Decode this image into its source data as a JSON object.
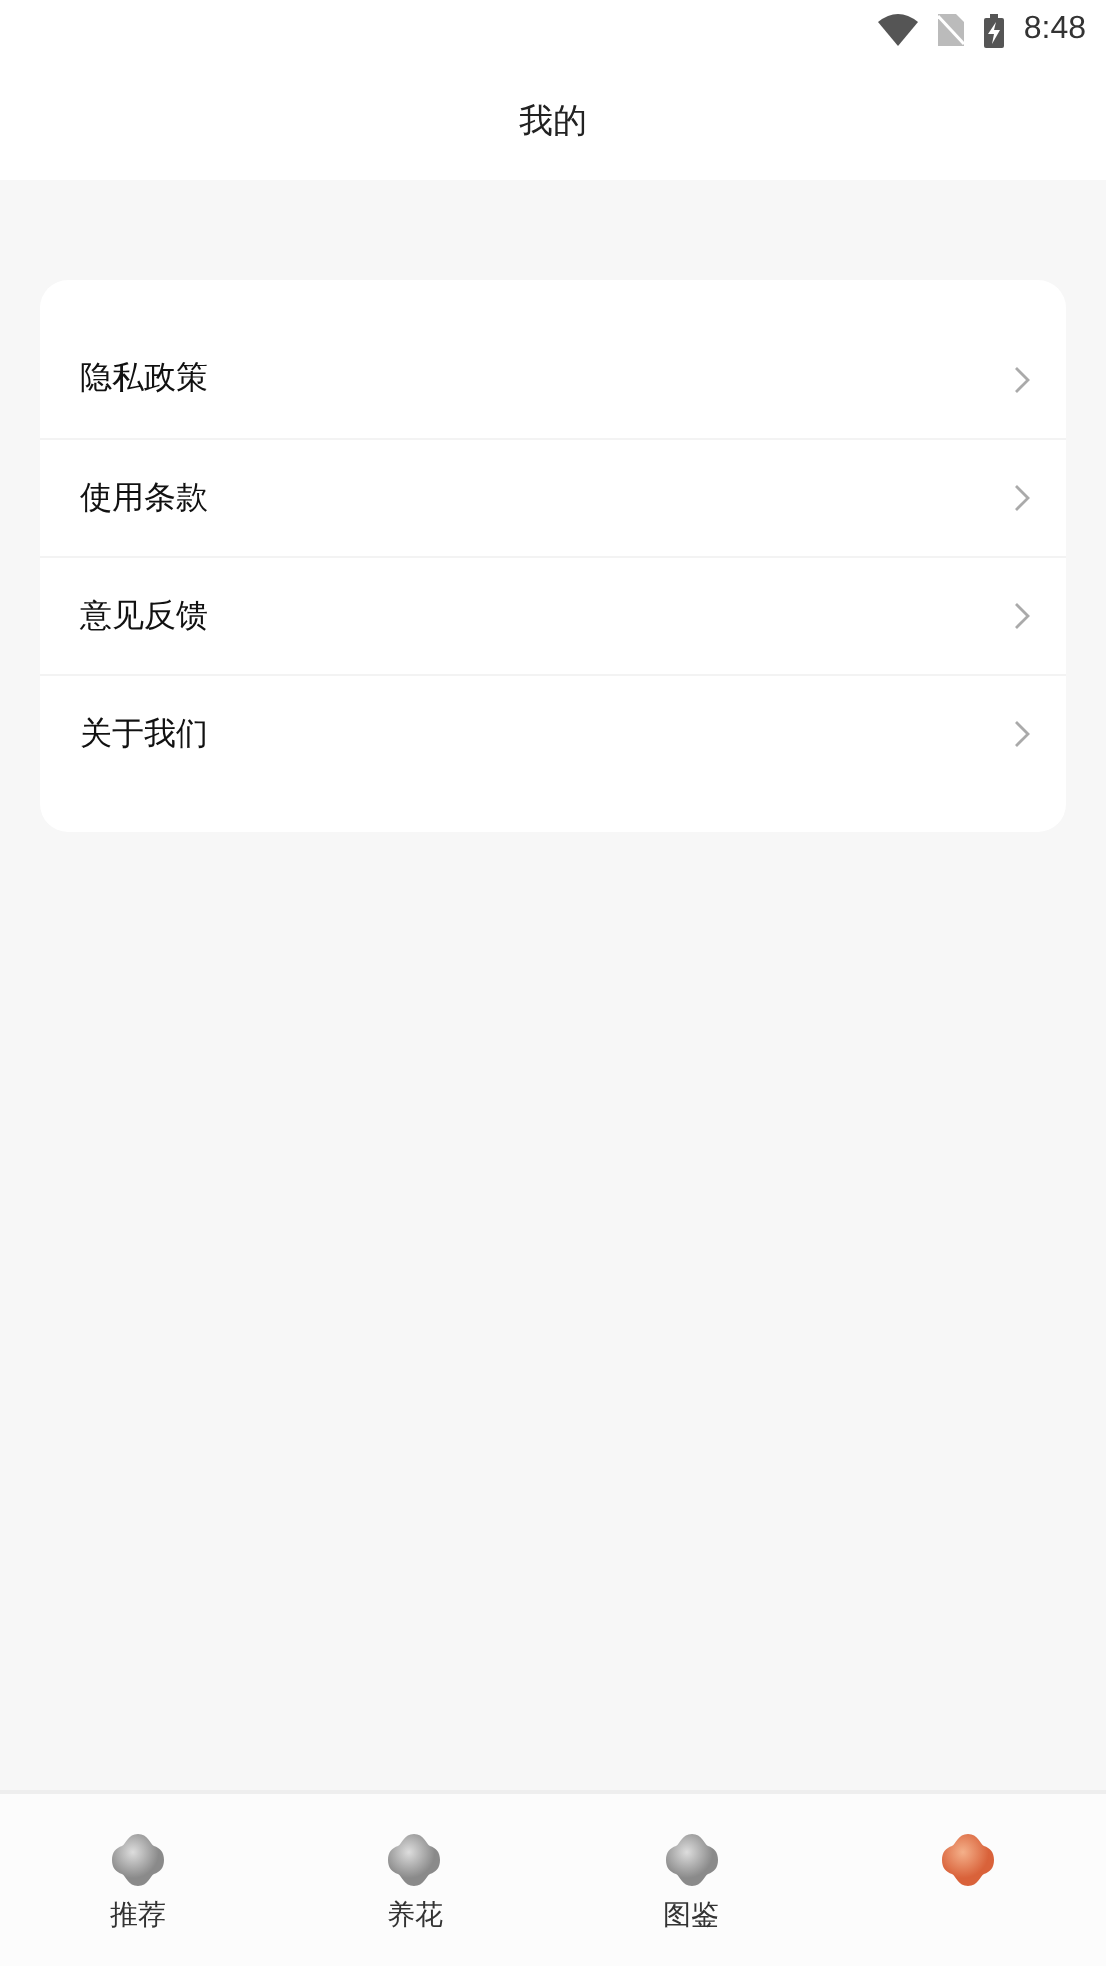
{
  "status_bar": {
    "time": "8:48"
  },
  "header": {
    "title": "我的"
  },
  "menu": [
    {
      "label": "隐私政策"
    },
    {
      "label": "使用条款"
    },
    {
      "label": "意见反馈"
    },
    {
      "label": "关于我们"
    }
  ],
  "tabs": [
    {
      "label": "推荐",
      "selected": false
    },
    {
      "label": "养花",
      "selected": false
    },
    {
      "label": "图鉴",
      "selected": false
    },
    {
      "selected": true
    }
  ]
}
